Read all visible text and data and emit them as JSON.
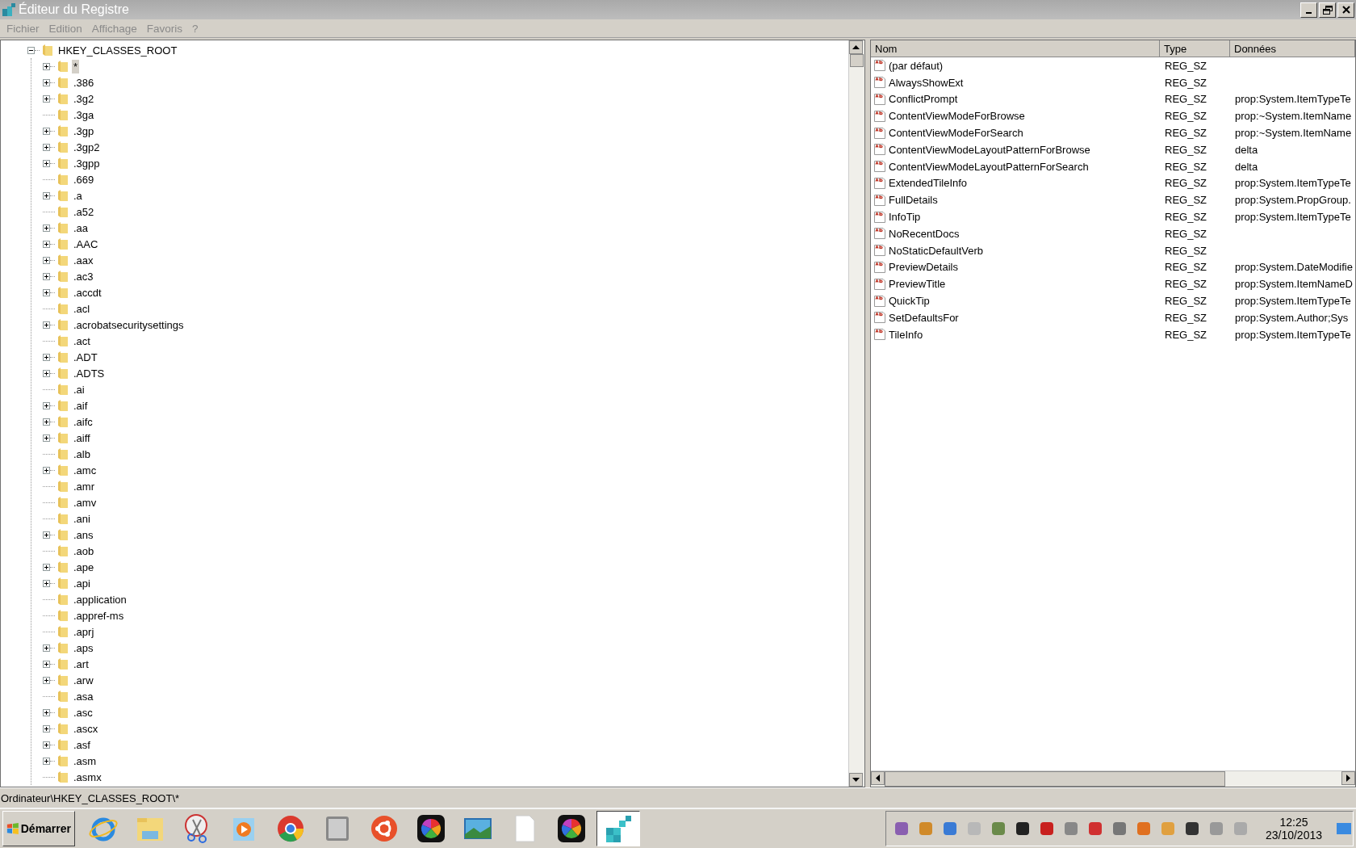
{
  "window": {
    "title": "Éditeur du Registre"
  },
  "menu": [
    "Fichier",
    "Edition",
    "Affichage",
    "Favoris",
    "?"
  ],
  "tree": {
    "label": "HKEY_CLASSES_ROOT",
    "expanded": true,
    "selected": false,
    "children": [
      {
        "label": "*",
        "has_children": true,
        "selected": true
      },
      {
        "label": ".386",
        "has_children": true,
        "selected": false
      },
      {
        "label": ".3g2",
        "has_children": true,
        "selected": false
      },
      {
        "label": ".3ga",
        "has_children": false,
        "selected": false
      },
      {
        "label": ".3gp",
        "has_children": true,
        "selected": false
      },
      {
        "label": ".3gp2",
        "has_children": true,
        "selected": false
      },
      {
        "label": ".3gpp",
        "has_children": true,
        "selected": false
      },
      {
        "label": ".669",
        "has_children": false,
        "selected": false
      },
      {
        "label": ".a",
        "has_children": true,
        "selected": false
      },
      {
        "label": ".a52",
        "has_children": false,
        "selected": false
      },
      {
        "label": ".aa",
        "has_children": true,
        "selected": false
      },
      {
        "label": ".AAC",
        "has_children": true,
        "selected": false
      },
      {
        "label": ".aax",
        "has_children": true,
        "selected": false
      },
      {
        "label": ".ac3",
        "has_children": true,
        "selected": false
      },
      {
        "label": ".accdt",
        "has_children": true,
        "selected": false
      },
      {
        "label": ".acl",
        "has_children": false,
        "selected": false
      },
      {
        "label": ".acrobatsecuritysettings",
        "has_children": true,
        "selected": false
      },
      {
        "label": ".act",
        "has_children": false,
        "selected": false
      },
      {
        "label": ".ADT",
        "has_children": true,
        "selected": false
      },
      {
        "label": ".ADTS",
        "has_children": true,
        "selected": false
      },
      {
        "label": ".ai",
        "has_children": false,
        "selected": false
      },
      {
        "label": ".aif",
        "has_children": true,
        "selected": false
      },
      {
        "label": ".aifc",
        "has_children": true,
        "selected": false
      },
      {
        "label": ".aiff",
        "has_children": true,
        "selected": false
      },
      {
        "label": ".alb",
        "has_children": false,
        "selected": false
      },
      {
        "label": ".amc",
        "has_children": true,
        "selected": false
      },
      {
        "label": ".amr",
        "has_children": false,
        "selected": false
      },
      {
        "label": ".amv",
        "has_children": false,
        "selected": false
      },
      {
        "label": ".ani",
        "has_children": false,
        "selected": false
      },
      {
        "label": ".ans",
        "has_children": true,
        "selected": false
      },
      {
        "label": ".aob",
        "has_children": false,
        "selected": false
      },
      {
        "label": ".ape",
        "has_children": true,
        "selected": false
      },
      {
        "label": ".api",
        "has_children": true,
        "selected": false
      },
      {
        "label": ".application",
        "has_children": false,
        "selected": false
      },
      {
        "label": ".appref-ms",
        "has_children": false,
        "selected": false
      },
      {
        "label": ".aprj",
        "has_children": false,
        "selected": false
      },
      {
        "label": ".aps",
        "has_children": true,
        "selected": false
      },
      {
        "label": ".art",
        "has_children": true,
        "selected": false
      },
      {
        "label": ".arw",
        "has_children": true,
        "selected": false
      },
      {
        "label": ".asa",
        "has_children": false,
        "selected": false
      },
      {
        "label": ".asc",
        "has_children": true,
        "selected": false
      },
      {
        "label": ".ascx",
        "has_children": true,
        "selected": false
      },
      {
        "label": ".asf",
        "has_children": true,
        "selected": false
      },
      {
        "label": ".asm",
        "has_children": true,
        "selected": false
      },
      {
        "label": ".asmx",
        "has_children": false,
        "selected": false
      }
    ]
  },
  "values": {
    "columns": [
      "Nom",
      "Type",
      "Données"
    ],
    "rows": [
      [
        "(par défaut)",
        "REG_SZ",
        ""
      ],
      [
        "AlwaysShowExt",
        "REG_SZ",
        ""
      ],
      [
        "ConflictPrompt",
        "REG_SZ",
        "prop:System.ItemTypeTe"
      ],
      [
        "ContentViewModeForBrowse",
        "REG_SZ",
        "prop:~System.ItemName"
      ],
      [
        "ContentViewModeForSearch",
        "REG_SZ",
        "prop:~System.ItemName"
      ],
      [
        "ContentViewModeLayoutPatternForBrowse",
        "REG_SZ",
        "delta"
      ],
      [
        "ContentViewModeLayoutPatternForSearch",
        "REG_SZ",
        "delta"
      ],
      [
        "ExtendedTileInfo",
        "REG_SZ",
        "prop:System.ItemTypeTe"
      ],
      [
        "FullDetails",
        "REG_SZ",
        "prop:System.PropGroup."
      ],
      [
        "InfoTip",
        "REG_SZ",
        "prop:System.ItemTypeTe"
      ],
      [
        "NoRecentDocs",
        "REG_SZ",
        ""
      ],
      [
        "NoStaticDefaultVerb",
        "REG_SZ",
        ""
      ],
      [
        "PreviewDetails",
        "REG_SZ",
        "prop:System.DateModifie"
      ],
      [
        "PreviewTitle",
        "REG_SZ",
        "prop:System.ItemNameD"
      ],
      [
        "QuickTip",
        "REG_SZ",
        "prop:System.ItemTypeTe"
      ],
      [
        "SetDefaultsFor",
        "REG_SZ",
        "prop:System.Author;Sys"
      ],
      [
        "TileInfo",
        "REG_SZ",
        "prop:System.ItemTypeTe"
      ]
    ]
  },
  "status_bar": "Ordinateur\\HKEY_CLASSES_ROOT\\*",
  "taskbar": {
    "start": "Démarrer",
    "apps": [
      {
        "kind": "browser-e",
        "selected": false
      },
      {
        "kind": "folder",
        "selected": false
      },
      {
        "kind": "scissors",
        "selected": false
      },
      {
        "kind": "player",
        "selected": false
      },
      {
        "kind": "chrome",
        "selected": false
      },
      {
        "kind": "device",
        "selected": false
      },
      {
        "kind": "ubuntu",
        "selected": false
      },
      {
        "kind": "pinwheel",
        "selected": false
      },
      {
        "kind": "landscape",
        "selected": false
      },
      {
        "kind": "document",
        "selected": false
      },
      {
        "kind": "pinwheel",
        "selected": false
      },
      {
        "kind": "cubes",
        "selected": true
      }
    ],
    "time": "12:25",
    "date": "23/10/2013"
  }
}
